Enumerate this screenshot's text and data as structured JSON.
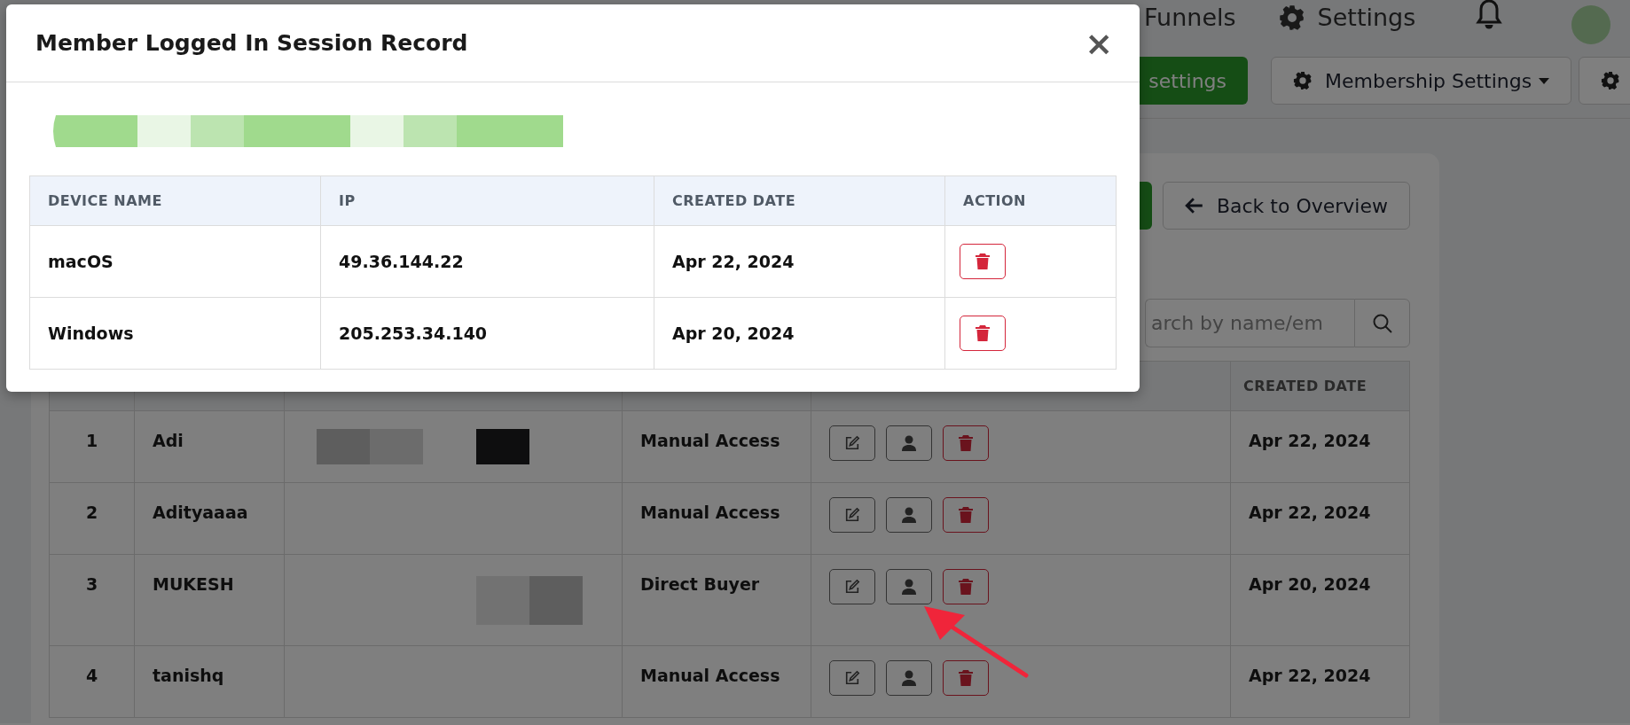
{
  "nav": [
    {
      "label": "Funnels",
      "kind": "plain"
    },
    {
      "label": "Settings",
      "kind": "gear"
    }
  ],
  "toolbar": [
    {
      "kind": "primary",
      "label": "settings"
    },
    {
      "kind": "dropdown",
      "label": "Membership Settings"
    },
    {
      "kind": "gear"
    }
  ],
  "card": {
    "buttons": [
      {
        "kind": "primary"
      },
      {
        "kind": "back",
        "label": "Back to Overview"
      }
    ],
    "search": {
      "placeholder": "arch by name/em"
    },
    "table": {
      "created_header": "CREATED DATE",
      "rows": [
        {
          "sno": "1",
          "name": "Adi",
          "email": {
            "kind": "redacted"
          },
          "purchase_type": "Manual Access",
          "created": "Apr 22, 2024"
        },
        {
          "sno": "2",
          "name": "Adityaaaa",
          "email": {
            "kind": "blank"
          },
          "purchase_type": "Manual Access",
          "created": "Apr 22, 2024"
        },
        {
          "sno": "3",
          "name": "MUKESH",
          "email": {
            "kind": "smudged"
          },
          "purchase_type": "Direct Buyer",
          "created": "Apr 20, 2024"
        },
        {
          "sno": "4",
          "name": "tanishq",
          "email": {
            "kind": "blank"
          },
          "purchase_type": "Manual Access",
          "created": "Apr 22, 2024"
        }
      ]
    }
  },
  "modal": {
    "title": "Member Logged In Session Record",
    "close": "×",
    "subtitle": {
      "kind": "redacted"
    },
    "columns": [
      "DEVICE NAME",
      "IP",
      "CREATED DATE",
      "ACTION"
    ],
    "rows": [
      {
        "device": "macOS",
        "ip": "49.36.144.22",
        "created": "Apr 22, 2024"
      },
      {
        "device": "Windows",
        "ip": "205.253.34.140",
        "created": "Apr 20, 2024"
      }
    ]
  },
  "annotation": {
    "kind": "arrow"
  }
}
